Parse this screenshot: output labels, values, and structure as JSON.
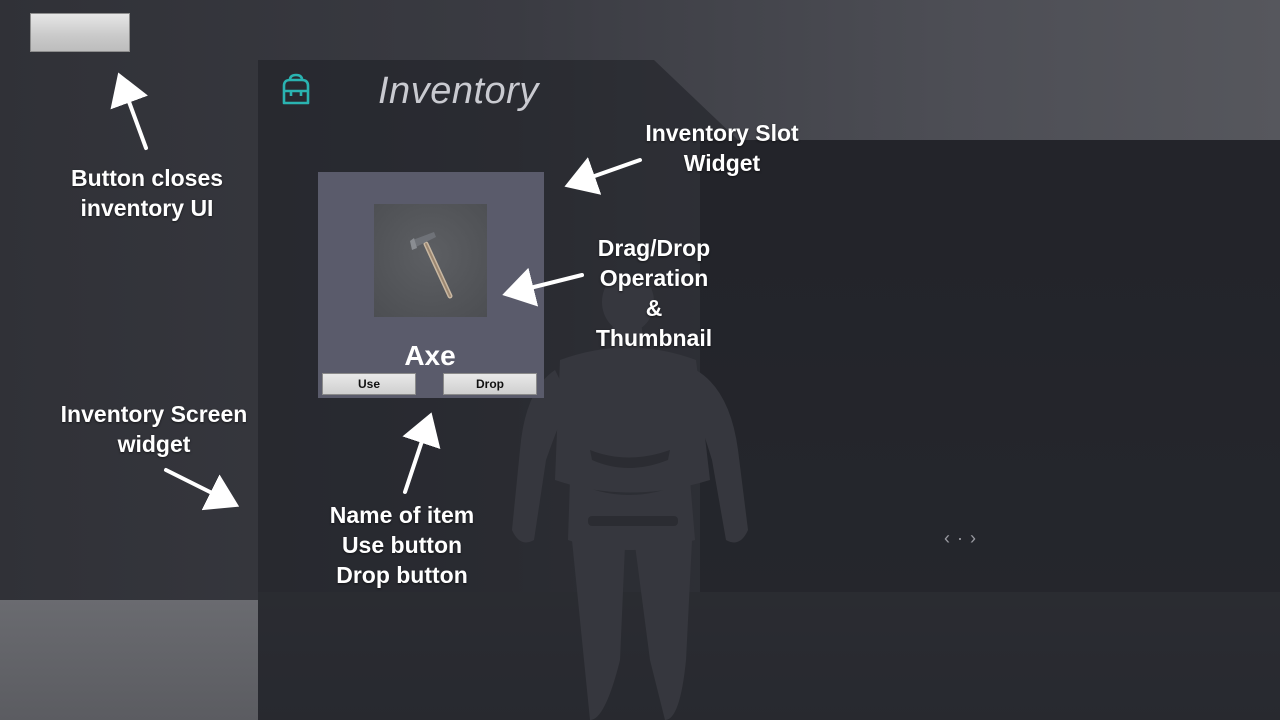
{
  "inventory": {
    "title": "Inventory",
    "icon": "backpack-icon",
    "accent_color": "#2ab3b1"
  },
  "close_button": {
    "label": ""
  },
  "slot": {
    "thumbnail_icon": "axe-icon",
    "item_name": "Axe",
    "use_label": "Use",
    "drop_label": "Drop"
  },
  "annotations": {
    "close_button_note": [
      "Button closes",
      "inventory UI"
    ],
    "slot_widget_note": [
      "Inventory Slot",
      "Widget"
    ],
    "drag_drop_note": [
      "Drag/Drop",
      "Operation",
      "&",
      "Thumbnail"
    ],
    "screen_widget_note": [
      "Inventory Screen",
      "widget"
    ],
    "slot_contents_note": [
      "Name of item",
      "Use button",
      "Drop button"
    ]
  },
  "nav_hint": "‹ · ›"
}
